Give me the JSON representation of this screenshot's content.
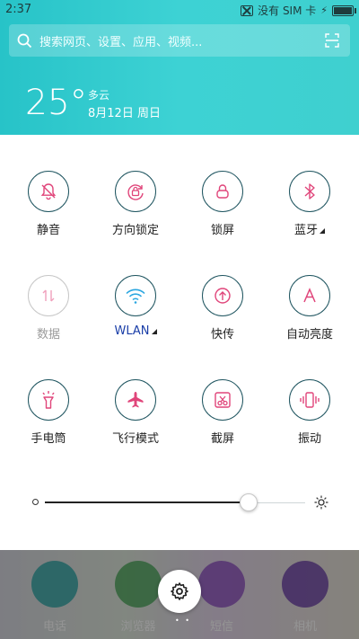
{
  "status_bar": {
    "time": "2:37",
    "sim_status": "没有 SIM 卡"
  },
  "search": {
    "placeholder": "搜索网页、设置、应用、视频..."
  },
  "weather": {
    "temperature": "25°",
    "condition": "多云",
    "date": "8月12日 周日"
  },
  "toggles": [
    {
      "label": "静音",
      "icon": "bell-off-icon",
      "active": true
    },
    {
      "label": "方向锁定",
      "icon": "rotation-lock-icon",
      "active": true
    },
    {
      "label": "锁屏",
      "icon": "lock-icon",
      "active": true
    },
    {
      "label": "蓝牙",
      "icon": "bluetooth-icon",
      "active": true,
      "has_menu": true
    },
    {
      "label": "数据",
      "icon": "mobile-data-icon",
      "active": false
    },
    {
      "label": "WLAN",
      "icon": "wifi-icon",
      "active": true,
      "has_menu": true
    },
    {
      "label": "快传",
      "icon": "quick-transfer-icon",
      "active": true
    },
    {
      "label": "自动亮度",
      "icon": "auto-brightness-icon",
      "active": true
    },
    {
      "label": "手电筒",
      "icon": "flashlight-icon",
      "active": true
    },
    {
      "label": "飞行模式",
      "icon": "airplane-icon",
      "active": true
    },
    {
      "label": "截屏",
      "icon": "screenshot-icon",
      "active": true
    },
    {
      "label": "振动",
      "icon": "vibrate-icon",
      "active": true
    }
  ],
  "brightness": {
    "level": 0.78
  },
  "dock": [
    {
      "label": "电话",
      "color": "#2aa6a6"
    },
    {
      "label": "浏览器",
      "color": "#4aa85a"
    },
    {
      "label": "短信",
      "color": "#8d4fc2"
    },
    {
      "label": "相机",
      "color": "#6a3fa8"
    }
  ],
  "colors": {
    "header": "#34cdd0",
    "icon_accent": "#e0457a",
    "wifi_accent": "#2aa6e0",
    "label_accent": "#1a3ea8"
  }
}
